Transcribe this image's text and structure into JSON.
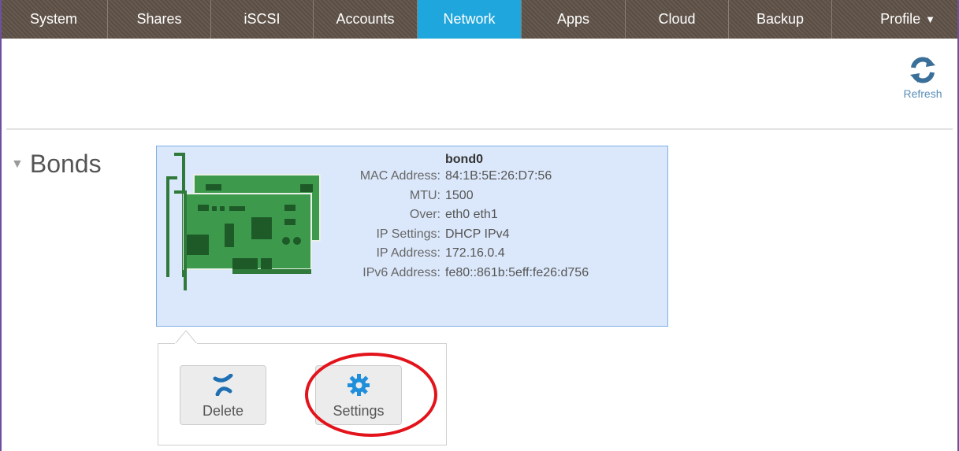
{
  "nav": {
    "tabs": [
      {
        "label": "System",
        "active": false
      },
      {
        "label": "Shares",
        "active": false
      },
      {
        "label": "iSCSI",
        "active": false
      },
      {
        "label": "Accounts",
        "active": false
      },
      {
        "label": "Network",
        "active": true
      },
      {
        "label": "Apps",
        "active": false
      },
      {
        "label": "Cloud",
        "active": false
      },
      {
        "label": "Backup",
        "active": false
      }
    ],
    "profile_label": "Profile"
  },
  "toolbar": {
    "refresh_label": "Refresh"
  },
  "section": {
    "title": "Bonds"
  },
  "bond": {
    "name": "bond0",
    "fields": [
      {
        "key": "MAC Address:",
        "value": "84:1B:5E:26:D7:56"
      },
      {
        "key": "MTU:",
        "value": "1500"
      },
      {
        "key": "Over:",
        "value": "eth0 eth1"
      },
      {
        "key": "IP Settings:",
        "value": "DHCP IPv4"
      },
      {
        "key": "IP Address:",
        "value": "172.16.0.4"
      },
      {
        "key": "IPv6 Address:",
        "value": "fe80::861b:5eff:fe26:d756"
      }
    ]
  },
  "actions": {
    "delete_label": "Delete",
    "settings_label": "Settings"
  },
  "colors": {
    "nav_bg": "#5f5248",
    "nav_active": "#1fa6dc",
    "card_bg": "#dbe8fb",
    "nic_green": "#2f8a3e",
    "highlight": "#e3131b"
  },
  "icons": {
    "refresh": "refresh-icon",
    "delete": "x-icon",
    "settings": "gear-icon",
    "nic": "network-card-icon",
    "collapse": "triangle-down-icon"
  }
}
